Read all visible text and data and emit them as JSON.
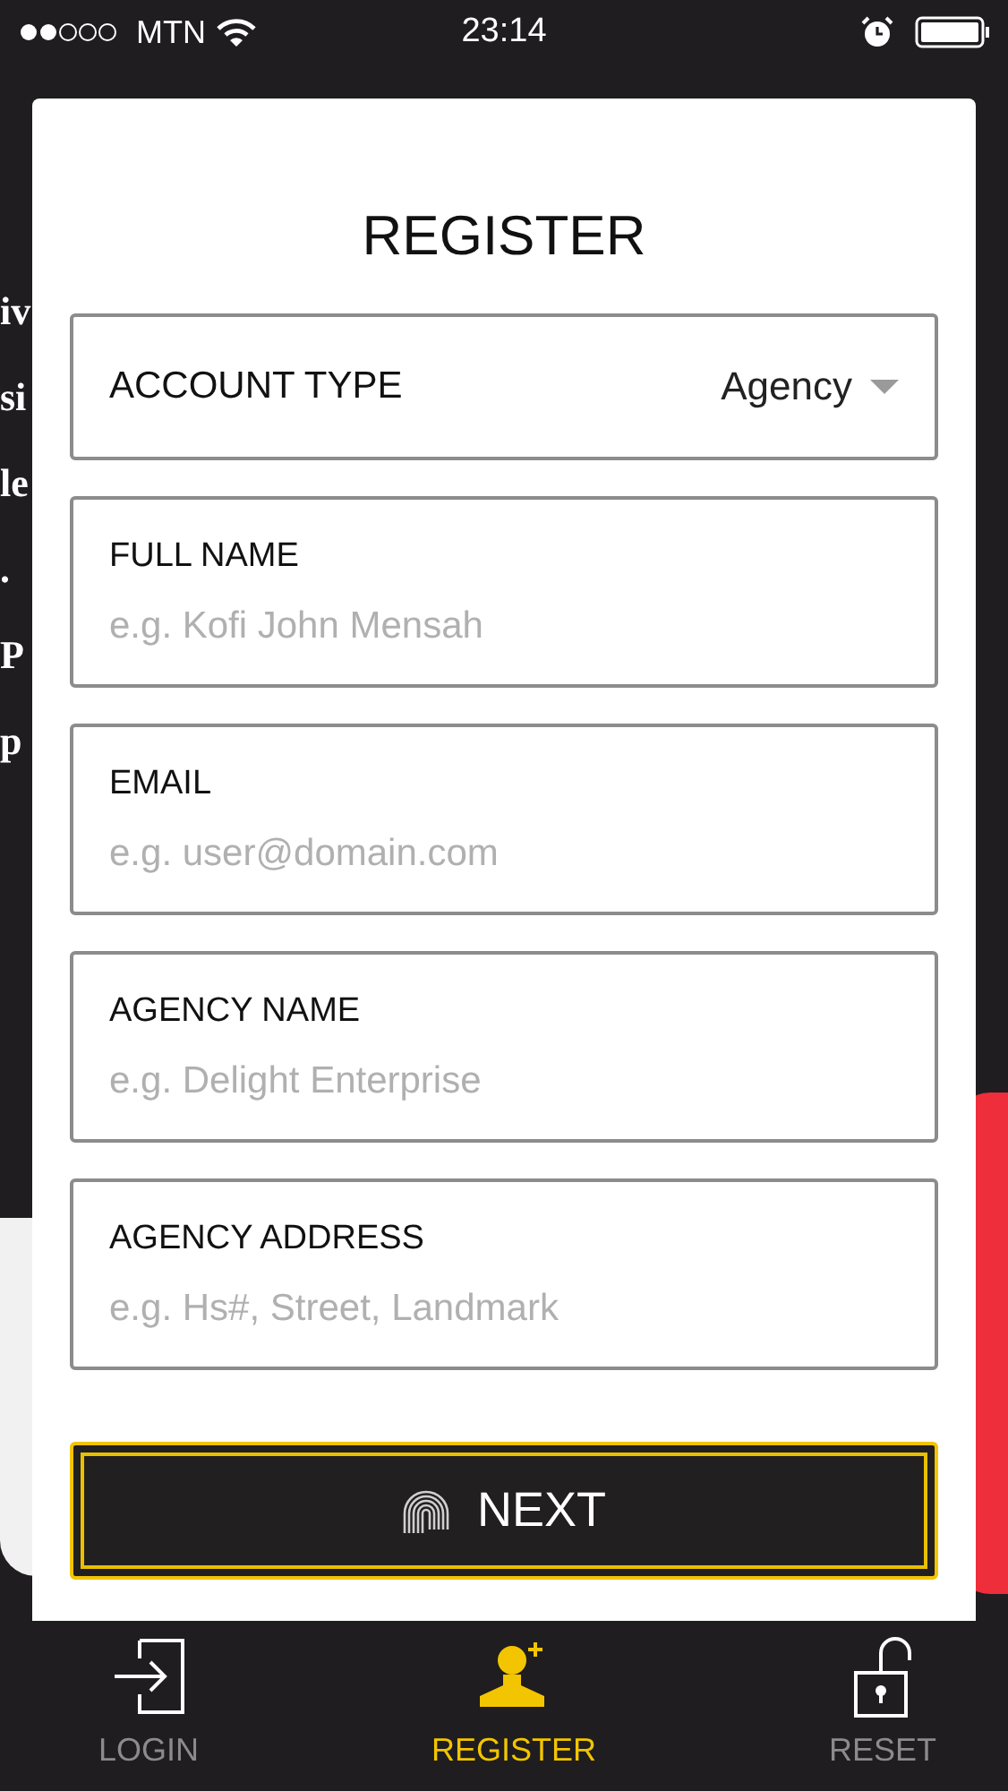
{
  "status_bar": {
    "carrier": "MTN",
    "time": "23:14"
  },
  "background_text": [
    "iv",
    "si",
    "le",
    ".",
    "P",
    "p"
  ],
  "form": {
    "title": "REGISTER",
    "account_type": {
      "label": "ACCOUNT TYPE",
      "value": "Agency"
    },
    "fields": [
      {
        "label": "FULL NAME",
        "placeholder": "e.g. Kofi John Mensah"
      },
      {
        "label": "EMAIL",
        "placeholder": "e.g. user@domain.com"
      },
      {
        "label": "AGENCY NAME",
        "placeholder": "e.g. Delight Enterprise"
      },
      {
        "label": "AGENCY ADDRESS",
        "placeholder": "e.g. Hs#, Street, Landmark"
      }
    ],
    "next_button": "NEXT"
  },
  "tab_bar": [
    {
      "kind": "login",
      "label": "LOGIN",
      "selected": false
    },
    {
      "kind": "register",
      "label": "REGISTER",
      "selected": true
    },
    {
      "kind": "reset",
      "label": "RESET",
      "selected": false
    }
  ]
}
